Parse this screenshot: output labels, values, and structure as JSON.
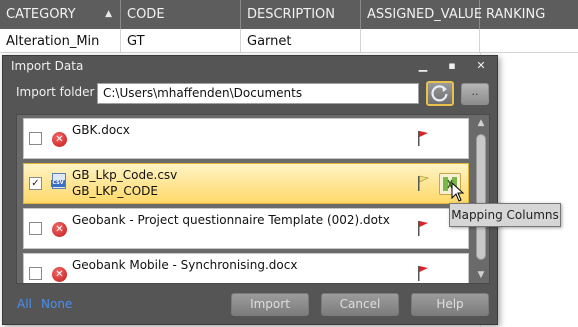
{
  "grid": {
    "columns": [
      "CATEGORY",
      "CODE",
      "DESCRIPTION",
      "ASSIGNED_VALUE",
      "RANKING"
    ],
    "row": [
      "Alteration_Min",
      "GT",
      "Garnet",
      "",
      ""
    ]
  },
  "dialog": {
    "title": "Import Data",
    "folder_label": "Import folder",
    "folder_path": "C:\\Users\\mhaffenden\\Documents",
    "browse_label": "..",
    "items": [
      {
        "name": "GBK.docx",
        "sub": ""
      },
      {
        "name": "GB_Lkp_Code.csv",
        "sub": "GB_LKP_CODE"
      },
      {
        "name": "Geobank - Project questionnaire Template (002).dotx",
        "sub": ""
      },
      {
        "name": "Geobank Mobile - Synchronising.docx",
        "sub": ""
      }
    ],
    "links": {
      "all": "All",
      "none": "None"
    },
    "buttons": {
      "import": "Import",
      "cancel": "Cancel",
      "help": "Help"
    }
  },
  "tooltip": "Mapping Columns",
  "colors": {
    "accent": "#e8c04a",
    "selected_row": "#ffd96a",
    "link": "#4a8ff2",
    "error": "#c21818"
  }
}
